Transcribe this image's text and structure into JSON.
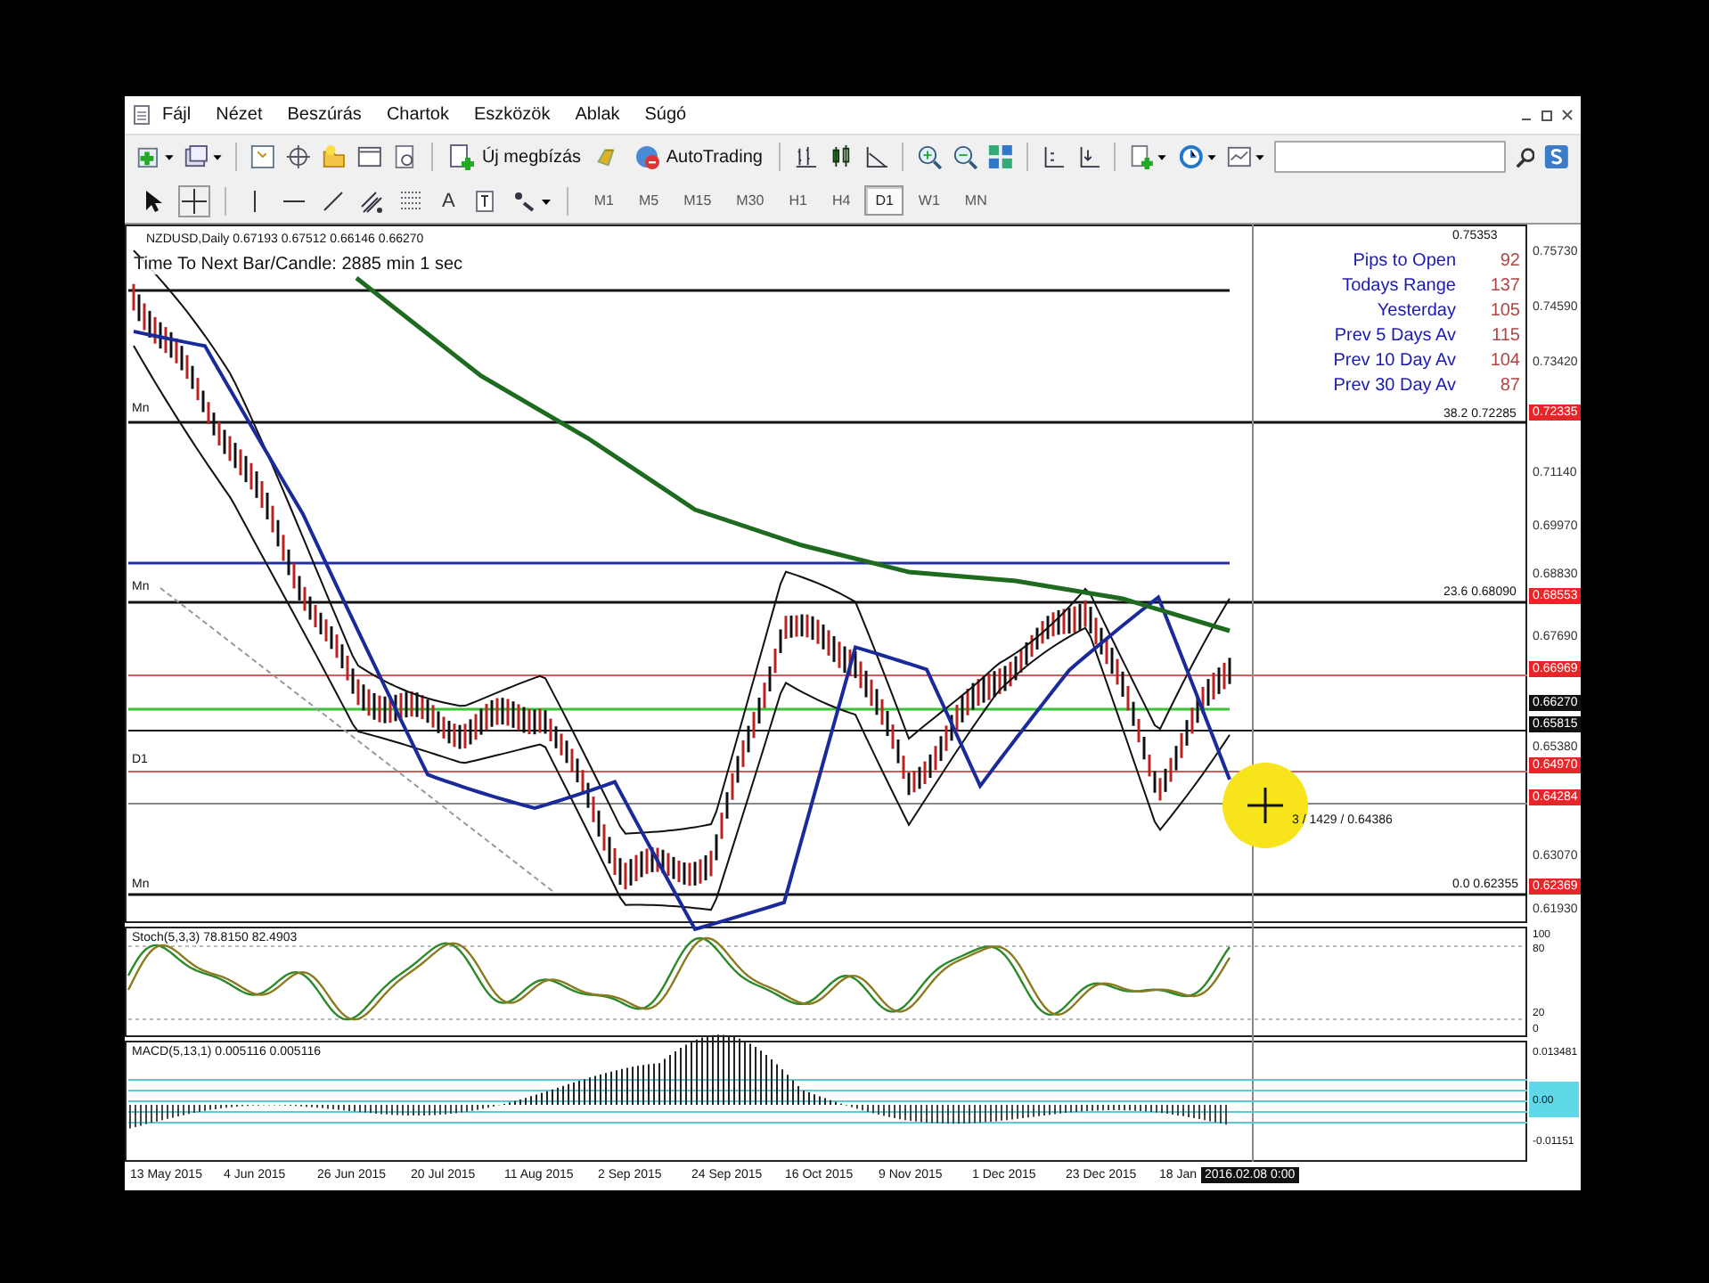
{
  "menu": [
    "Fájl",
    "Nézet",
    "Beszúrás",
    "Chartok",
    "Eszközök",
    "Ablak",
    "Súgó"
  ],
  "toolbar": {
    "order_button": "Új megbízás",
    "autotrading_button": "AutoTrading",
    "text_tool": "A"
  },
  "timeframes": [
    {
      "label": "M1",
      "selected": false
    },
    {
      "label": "M5",
      "selected": false
    },
    {
      "label": "M15",
      "selected": false
    },
    {
      "label": "M30",
      "selected": false
    },
    {
      "label": "H1",
      "selected": false
    },
    {
      "label": "H4",
      "selected": false
    },
    {
      "label": "D1",
      "selected": true
    },
    {
      "label": "W1",
      "selected": false
    },
    {
      "label": "MN",
      "selected": false
    }
  ],
  "chart": {
    "symbol_line": "NZDUSD,Daily 0.67193 0.67512 0.66146 0.66270",
    "timer": "Time To Next Bar/Candle: 2885 min 1 sec",
    "stats": [
      {
        "label": "Pips to Open",
        "value": "92"
      },
      {
        "label": "Todays Range",
        "value": "137"
      },
      {
        "label": "Yesterday",
        "value": "105"
      },
      {
        "label": "Prev 5 Days Av",
        "value": "115"
      },
      {
        "label": "Prev 10 Day Av",
        "value": "104"
      },
      {
        "label": "Prev 30 Day Av",
        "value": "87"
      }
    ],
    "price_axis": [
      {
        "label": "0.75730",
        "kind": "plain"
      },
      {
        "label": "0.74590",
        "kind": "plain"
      },
      {
        "label": "0.73420",
        "kind": "plain"
      },
      {
        "label": "0.72335",
        "kind": "alert"
      },
      {
        "label": "0.71140",
        "kind": "plain"
      },
      {
        "label": "0.69970",
        "kind": "plain"
      },
      {
        "label": "0.68830",
        "kind": "plain"
      },
      {
        "label": "0.68553",
        "kind": "alert"
      },
      {
        "label": "0.67690",
        "kind": "plain"
      },
      {
        "label": "0.66969",
        "kind": "alert"
      },
      {
        "label": "0.66270",
        "kind": "current"
      },
      {
        "label": "0.65815",
        "kind": "current"
      },
      {
        "label": "0.65380",
        "kind": "plain"
      },
      {
        "label": "0.64970",
        "kind": "alert"
      },
      {
        "label": "0.64284",
        "kind": "alert"
      },
      {
        "label": "0.63070",
        "kind": "plain"
      },
      {
        "label": "0.62369",
        "kind": "alert"
      },
      {
        "label": "0.61930",
        "kind": "plain"
      }
    ],
    "fib_labels": [
      "0.75353",
      "38.2 0.72285",
      "23.6 0.68090",
      "0.0 0.62355"
    ],
    "line_labels": [
      "Mn",
      "Mn",
      "D1",
      "Mn"
    ],
    "crosshair_label": "3 / 1429 / 0.64386",
    "stoch": {
      "title": "Stoch(5,3,3) 78.8150 82.4903",
      "scale": [
        "100",
        "80",
        "20",
        "0"
      ]
    },
    "macd": {
      "title": "MACD(5,13,1) 0.005116 0.005116",
      "scale": [
        "0.013481",
        "0.00",
        "-0.01151"
      ]
    },
    "dates": [
      "13 May 2015",
      "4 Jun 2015",
      "26 Jun 2015",
      "20 Jul 2015",
      "11 Aug 2015",
      "2 Sep 2015",
      "24 Sep 2015",
      "16 Oct 2015",
      "9 Nov 2015",
      "1 Dec 2015",
      "23 Dec 2015",
      "18 Jan"
    ],
    "cursor_date": "2016.02.08 0:00"
  }
}
